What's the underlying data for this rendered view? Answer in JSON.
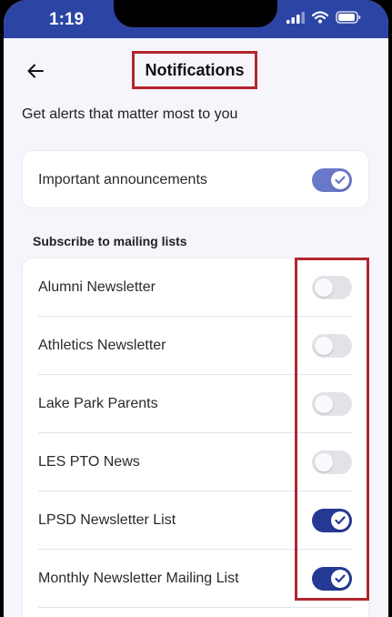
{
  "status_bar": {
    "time": "1:19"
  },
  "header": {
    "title": "Notifications"
  },
  "subtitle": "Get alerts that matter most to you",
  "announcements": {
    "label": "Important announcements",
    "enabled": true
  },
  "mailing_lists": {
    "section_title": "Subscribe to mailing lists",
    "items": [
      {
        "label": "Alumni Newsletter",
        "enabled": false
      },
      {
        "label": "Athletics Newsletter",
        "enabled": false
      },
      {
        "label": "Lake Park Parents",
        "enabled": false
      },
      {
        "label": "LES PTO News",
        "enabled": false
      },
      {
        "label": "LPSD Newsletter List",
        "enabled": true
      },
      {
        "label": "Monthly Newsletter Mailing List",
        "enabled": true
      }
    ]
  },
  "colors": {
    "status_bar": "#2c45a5",
    "toggle_on_announcements": "#6a78c9",
    "toggle_on": "#253a94",
    "toggle_off": "#e3e2e8",
    "highlight": "#b3262e"
  },
  "icons": [
    "back-arrow-icon",
    "cellular-signal-icon",
    "wifi-icon",
    "battery-icon",
    "checkmark-icon"
  ]
}
